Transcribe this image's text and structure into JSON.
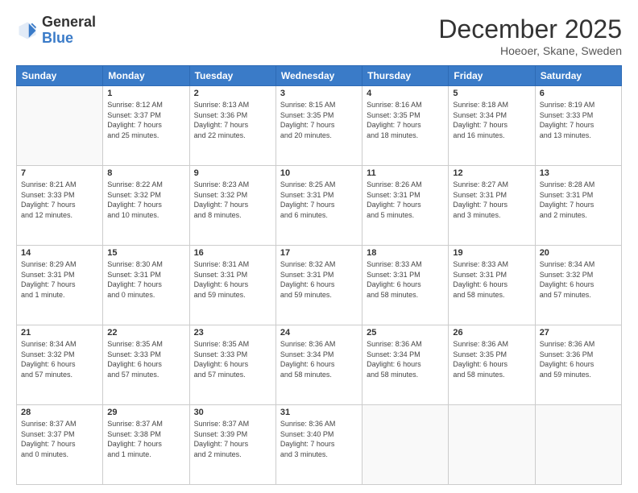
{
  "logo": {
    "general": "General",
    "blue": "Blue"
  },
  "header": {
    "month": "December 2025",
    "location": "Hoeoer, Skane, Sweden"
  },
  "weekdays": [
    "Sunday",
    "Monday",
    "Tuesday",
    "Wednesday",
    "Thursday",
    "Friday",
    "Saturday"
  ],
  "weeks": [
    [
      {
        "day": "",
        "info": ""
      },
      {
        "day": "1",
        "info": "Sunrise: 8:12 AM\nSunset: 3:37 PM\nDaylight: 7 hours\nand 25 minutes."
      },
      {
        "day": "2",
        "info": "Sunrise: 8:13 AM\nSunset: 3:36 PM\nDaylight: 7 hours\nand 22 minutes."
      },
      {
        "day": "3",
        "info": "Sunrise: 8:15 AM\nSunset: 3:35 PM\nDaylight: 7 hours\nand 20 minutes."
      },
      {
        "day": "4",
        "info": "Sunrise: 8:16 AM\nSunset: 3:35 PM\nDaylight: 7 hours\nand 18 minutes."
      },
      {
        "day": "5",
        "info": "Sunrise: 8:18 AM\nSunset: 3:34 PM\nDaylight: 7 hours\nand 16 minutes."
      },
      {
        "day": "6",
        "info": "Sunrise: 8:19 AM\nSunset: 3:33 PM\nDaylight: 7 hours\nand 13 minutes."
      }
    ],
    [
      {
        "day": "7",
        "info": "Sunrise: 8:21 AM\nSunset: 3:33 PM\nDaylight: 7 hours\nand 12 minutes."
      },
      {
        "day": "8",
        "info": "Sunrise: 8:22 AM\nSunset: 3:32 PM\nDaylight: 7 hours\nand 10 minutes."
      },
      {
        "day": "9",
        "info": "Sunrise: 8:23 AM\nSunset: 3:32 PM\nDaylight: 7 hours\nand 8 minutes."
      },
      {
        "day": "10",
        "info": "Sunrise: 8:25 AM\nSunset: 3:31 PM\nDaylight: 7 hours\nand 6 minutes."
      },
      {
        "day": "11",
        "info": "Sunrise: 8:26 AM\nSunset: 3:31 PM\nDaylight: 7 hours\nand 5 minutes."
      },
      {
        "day": "12",
        "info": "Sunrise: 8:27 AM\nSunset: 3:31 PM\nDaylight: 7 hours\nand 3 minutes."
      },
      {
        "day": "13",
        "info": "Sunrise: 8:28 AM\nSunset: 3:31 PM\nDaylight: 7 hours\nand 2 minutes."
      }
    ],
    [
      {
        "day": "14",
        "info": "Sunrise: 8:29 AM\nSunset: 3:31 PM\nDaylight: 7 hours\nand 1 minute."
      },
      {
        "day": "15",
        "info": "Sunrise: 8:30 AM\nSunset: 3:31 PM\nDaylight: 7 hours\nand 0 minutes."
      },
      {
        "day": "16",
        "info": "Sunrise: 8:31 AM\nSunset: 3:31 PM\nDaylight: 6 hours\nand 59 minutes."
      },
      {
        "day": "17",
        "info": "Sunrise: 8:32 AM\nSunset: 3:31 PM\nDaylight: 6 hours\nand 59 minutes."
      },
      {
        "day": "18",
        "info": "Sunrise: 8:33 AM\nSunset: 3:31 PM\nDaylight: 6 hours\nand 58 minutes."
      },
      {
        "day": "19",
        "info": "Sunrise: 8:33 AM\nSunset: 3:31 PM\nDaylight: 6 hours\nand 58 minutes."
      },
      {
        "day": "20",
        "info": "Sunrise: 8:34 AM\nSunset: 3:32 PM\nDaylight: 6 hours\nand 57 minutes."
      }
    ],
    [
      {
        "day": "21",
        "info": "Sunrise: 8:34 AM\nSunset: 3:32 PM\nDaylight: 6 hours\nand 57 minutes."
      },
      {
        "day": "22",
        "info": "Sunrise: 8:35 AM\nSunset: 3:33 PM\nDaylight: 6 hours\nand 57 minutes."
      },
      {
        "day": "23",
        "info": "Sunrise: 8:35 AM\nSunset: 3:33 PM\nDaylight: 6 hours\nand 57 minutes."
      },
      {
        "day": "24",
        "info": "Sunrise: 8:36 AM\nSunset: 3:34 PM\nDaylight: 6 hours\nand 58 minutes."
      },
      {
        "day": "25",
        "info": "Sunrise: 8:36 AM\nSunset: 3:34 PM\nDaylight: 6 hours\nand 58 minutes."
      },
      {
        "day": "26",
        "info": "Sunrise: 8:36 AM\nSunset: 3:35 PM\nDaylight: 6 hours\nand 58 minutes."
      },
      {
        "day": "27",
        "info": "Sunrise: 8:36 AM\nSunset: 3:36 PM\nDaylight: 6 hours\nand 59 minutes."
      }
    ],
    [
      {
        "day": "28",
        "info": "Sunrise: 8:37 AM\nSunset: 3:37 PM\nDaylight: 7 hours\nand 0 minutes."
      },
      {
        "day": "29",
        "info": "Sunrise: 8:37 AM\nSunset: 3:38 PM\nDaylight: 7 hours\nand 1 minute."
      },
      {
        "day": "30",
        "info": "Sunrise: 8:37 AM\nSunset: 3:39 PM\nDaylight: 7 hours\nand 2 minutes."
      },
      {
        "day": "31",
        "info": "Sunrise: 8:36 AM\nSunset: 3:40 PM\nDaylight: 7 hours\nand 3 minutes."
      },
      {
        "day": "",
        "info": ""
      },
      {
        "day": "",
        "info": ""
      },
      {
        "day": "",
        "info": ""
      }
    ]
  ]
}
